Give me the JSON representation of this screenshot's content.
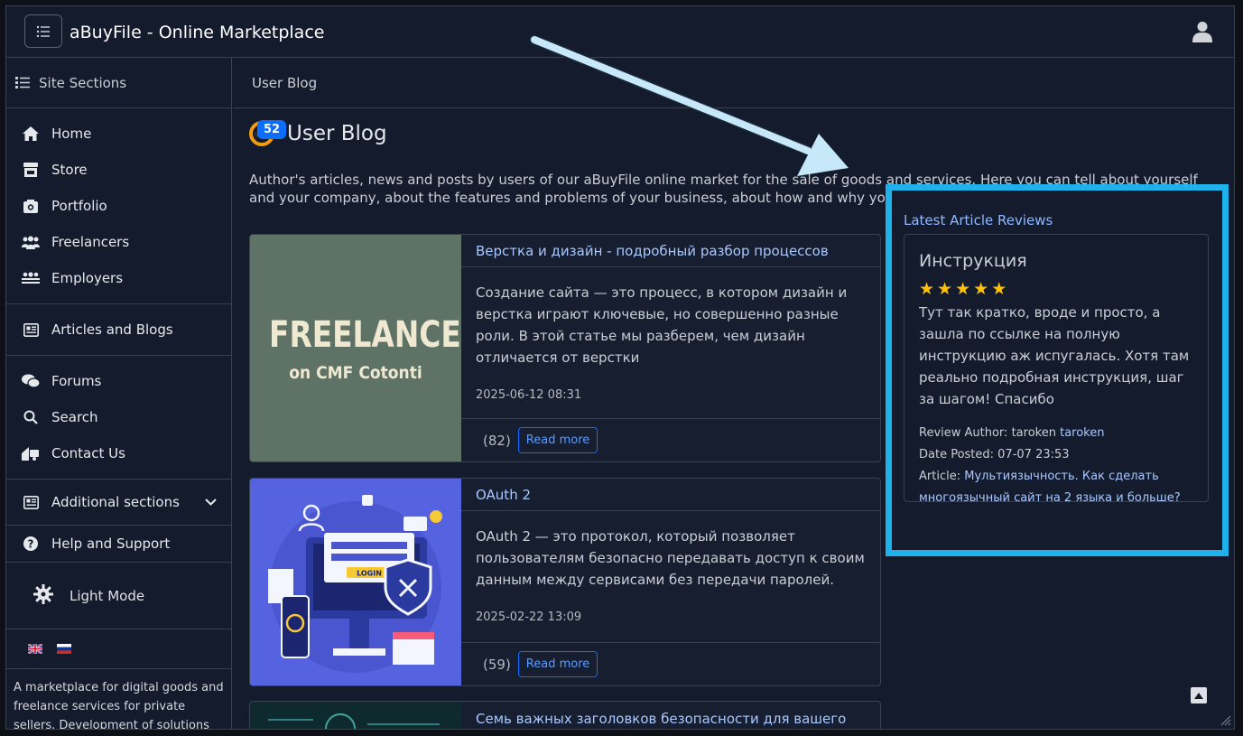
{
  "app": {
    "title": "aBuyFile - Online Marketplace"
  },
  "sidebar": {
    "header": "Site Sections",
    "items": [
      {
        "label": "Home",
        "icon": "home-icon"
      },
      {
        "label": "Store",
        "icon": "store-icon"
      },
      {
        "label": "Portfolio",
        "icon": "portfolio-icon"
      },
      {
        "label": "Freelancers",
        "icon": "freelancers-icon"
      },
      {
        "label": "Employers",
        "icon": "employers-icon"
      },
      {
        "label": "Articles and Blogs",
        "icon": "articles-icon"
      },
      {
        "label": "Forums",
        "icon": "forums-icon"
      },
      {
        "label": "Search",
        "icon": "search-icon"
      },
      {
        "label": "Contact Us",
        "icon": "contact-icon"
      },
      {
        "label": "Additional sections",
        "icon": "additional-icon"
      },
      {
        "label": "Help and Support",
        "icon": "help-icon"
      }
    ],
    "light_mode": "Light Mode",
    "footer": "A marketplace for digital goods and freelance services for private sellers. Development of solutions on Cotonti"
  },
  "main": {
    "breadcrumb": "User Blog",
    "badge": "52",
    "title": "User Blog",
    "description": "Author's articles, news and posts by users of our aBuyFile online market for the sale of goods and services. Here you can tell about yourself and your company, about the features and problems of your business, about how and why you decided to work on the",
    "posts": [
      {
        "title": "Верстка и дизайн - подробный разбор процессов",
        "excerpt": "Создание сайта — это процесс, в котором дизайн и верстка играют ключевые, но совершенно разные роли. В этой статье мы разберем, чем дизайн отличается от верстки",
        "date": "2025-06-12 08:31",
        "count": "(82)",
        "read_more": "Read more",
        "thumb_line1": "FREELANCE",
        "thumb_line2": "on CMF Cotonti"
      },
      {
        "title": "OAuth 2",
        "excerpt": "OAuth 2 — это протокол, который позволяет пользователям безопасно передавать доступ к своим данным между сервисами без передачи паролей.",
        "date": "2025-02-22 13:09",
        "count": "(59)",
        "read_more": "Read more",
        "thumb_login": "LOGIN"
      },
      {
        "title": "Семь важных заголовков безопасности для вашего веб-сайта"
      }
    ]
  },
  "reviews": {
    "heading": "Latest Article Reviews",
    "item": {
      "name": "Инструкция",
      "rating": 5,
      "text": "Тут так кратко, вроде и просто, а зашла по ссылке на полную инструкцию аж испугалась. Хотя там реально подробная инструкция, шаг за шагом! Спасибо",
      "author_label": "Review Author: taroken",
      "author_link": "taroken",
      "date_label": "Date Posted: 07-07 23:53",
      "article_label": "Article:",
      "article_link": "Мультиязычность. Как сделать многоязычный сайт на 2 языка и больше?"
    }
  },
  "colors": {
    "accent": "#0d6efd",
    "highlight": "#1fb1ec",
    "star": "#ffc107"
  }
}
